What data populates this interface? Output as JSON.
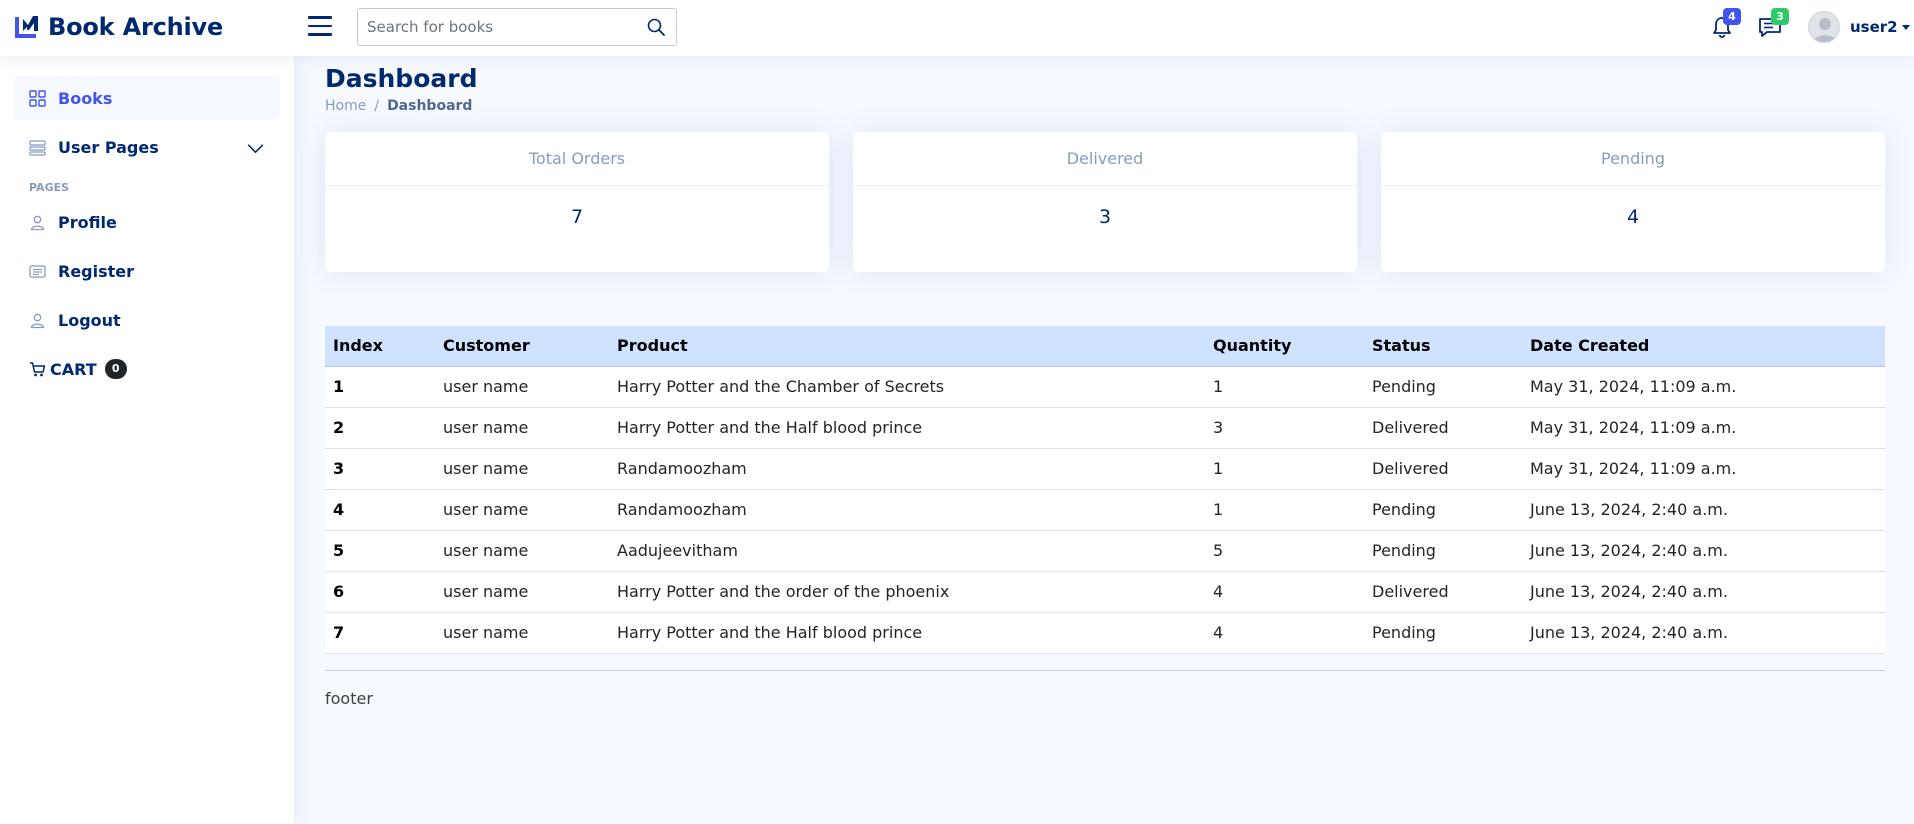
{
  "app": {
    "title": "Book Archive"
  },
  "search": {
    "placeholder": "Search for books"
  },
  "header": {
    "notifications_count": "4",
    "messages_count": "3",
    "user_name": "user2"
  },
  "sidebar": {
    "items": [
      {
        "label": "Books",
        "icon": "grid-icon",
        "active": true
      },
      {
        "label": "User Pages",
        "icon": "menu-icon"
      }
    ],
    "pages_heading": "PAGES",
    "pages": [
      {
        "label": "Profile",
        "icon": "person-icon"
      },
      {
        "label": "Register",
        "icon": "card-list-icon"
      },
      {
        "label": "Logout",
        "icon": "person-icon"
      }
    ],
    "cart": {
      "label": "CART",
      "count": "0",
      "icon": "cart-icon"
    }
  },
  "page": {
    "title": "Dashboard",
    "breadcrumb": {
      "home": "Home",
      "separator": "/",
      "current": "Dashboard"
    }
  },
  "cards": [
    {
      "title": "Total Orders",
      "value": "7"
    },
    {
      "title": "Delivered",
      "value": "3"
    },
    {
      "title": "Pending",
      "value": "4"
    }
  ],
  "table": {
    "headers": [
      "Index",
      "Customer",
      "Product",
      "Quantity",
      "Status",
      "Date Created"
    ],
    "rows": [
      [
        "1",
        "user name",
        "Harry Potter and the Chamber of Secrets",
        "1",
        "Pending",
        "May 31, 2024, 11:09 a.m."
      ],
      [
        "2",
        "user name",
        "Harry Potter and the Half blood prince",
        "3",
        "Delivered",
        "May 31, 2024, 11:09 a.m."
      ],
      [
        "3",
        "user name",
        "Randamoozham",
        "1",
        "Delivered",
        "May 31, 2024, 11:09 a.m."
      ],
      [
        "4",
        "user name",
        "Randamoozham",
        "1",
        "Pending",
        "June 13, 2024, 2:40 a.m."
      ],
      [
        "5",
        "user name",
        "Aadujeevitham",
        "5",
        "Pending",
        "June 13, 2024, 2:40 a.m."
      ],
      [
        "6",
        "user name",
        "Harry Potter and the order of the phoenix",
        "4",
        "Delivered",
        "June 13, 2024, 2:40 a.m."
      ],
      [
        "7",
        "user name",
        "Harry Potter and the Half blood prince",
        "4",
        "Pending",
        "June 13, 2024, 2:40 a.m."
      ]
    ]
  },
  "footer": {
    "text": "footer"
  },
  "colors": {
    "brand": "#012970",
    "accent": "#4154f1",
    "table_header_bg": "#cfe2ff",
    "page_bg": "#f6f9ff"
  }
}
